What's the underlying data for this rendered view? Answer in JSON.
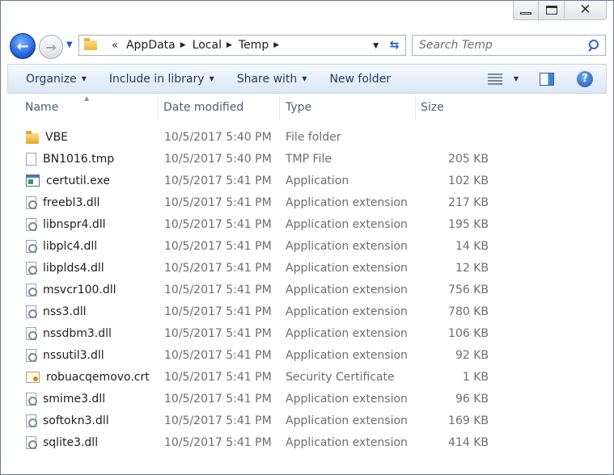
{
  "window": {
    "caption_buttons": {
      "minimize_icon": "minimize-icon",
      "maximize_icon": "maximize-icon",
      "close_icon": "close-icon"
    }
  },
  "address": {
    "overflow": "«",
    "crumbs": [
      "AppData",
      "Local",
      "Temp"
    ]
  },
  "search": {
    "placeholder": "Search Temp"
  },
  "toolbar": {
    "organize": "Organize",
    "include_in_library": "Include in library",
    "share_with": "Share with",
    "new_folder": "New folder"
  },
  "columns": {
    "name": "Name",
    "date": "Date modified",
    "type": "Type",
    "size": "Size"
  },
  "files": [
    {
      "icon": "folder",
      "name": "VBE",
      "date": "10/5/2017 5:40 PM",
      "type": "File folder",
      "size": ""
    },
    {
      "icon": "file",
      "name": "BN1016.tmp",
      "date": "10/5/2017 5:40 PM",
      "type": "TMP File",
      "size": "205 KB"
    },
    {
      "icon": "exe",
      "name": "certutil.exe",
      "date": "10/5/2017 5:41 PM",
      "type": "Application",
      "size": "102 KB"
    },
    {
      "icon": "dll",
      "name": "freebl3.dll",
      "date": "10/5/2017 5:41 PM",
      "type": "Application extension",
      "size": "217 KB"
    },
    {
      "icon": "dll",
      "name": "libnspr4.dll",
      "date": "10/5/2017 5:41 PM",
      "type": "Application extension",
      "size": "195 KB"
    },
    {
      "icon": "dll",
      "name": "libplc4.dll",
      "date": "10/5/2017 5:41 PM",
      "type": "Application extension",
      "size": "14 KB"
    },
    {
      "icon": "dll",
      "name": "libplds4.dll",
      "date": "10/5/2017 5:41 PM",
      "type": "Application extension",
      "size": "12 KB"
    },
    {
      "icon": "dll",
      "name": "msvcr100.dll",
      "date": "10/5/2017 5:41 PM",
      "type": "Application extension",
      "size": "756 KB"
    },
    {
      "icon": "dll",
      "name": "nss3.dll",
      "date": "10/5/2017 5:41 PM",
      "type": "Application extension",
      "size": "780 KB"
    },
    {
      "icon": "dll",
      "name": "nssdbm3.dll",
      "date": "10/5/2017 5:41 PM",
      "type": "Application extension",
      "size": "106 KB"
    },
    {
      "icon": "dll",
      "name": "nssutil3.dll",
      "date": "10/5/2017 5:41 PM",
      "type": "Application extension",
      "size": "92 KB"
    },
    {
      "icon": "cert",
      "name": "robuacqemovo.crt",
      "date": "10/5/2017 5:41 PM",
      "type": "Security Certificate",
      "size": "1 KB"
    },
    {
      "icon": "dll",
      "name": "smime3.dll",
      "date": "10/5/2017 5:41 PM",
      "type": "Application extension",
      "size": "96 KB"
    },
    {
      "icon": "dll",
      "name": "softokn3.dll",
      "date": "10/5/2017 5:41 PM",
      "type": "Application extension",
      "size": "169 KB"
    },
    {
      "icon": "dll",
      "name": "sqlite3.dll",
      "date": "10/5/2017 5:41 PM",
      "type": "Application extension",
      "size": "414 KB"
    }
  ]
}
